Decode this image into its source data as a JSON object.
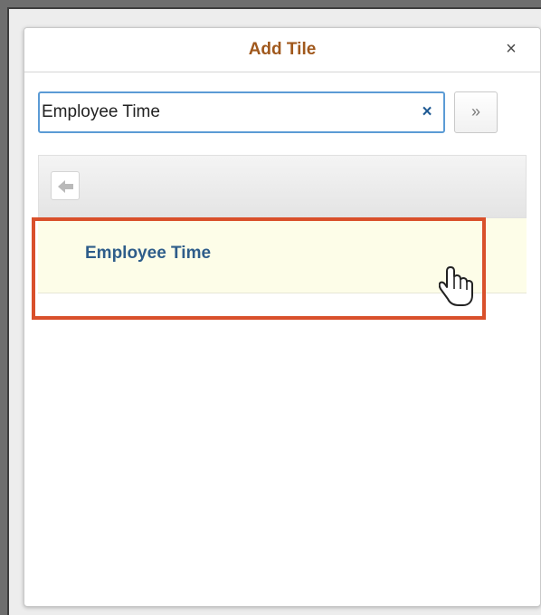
{
  "dialog": {
    "title": "Add Tile",
    "close_label": "×"
  },
  "search": {
    "value": "Employee Time",
    "clear_label": "×",
    "go_label": "»"
  },
  "results": {
    "back_icon": "back-arrow-icon",
    "items": [
      {
        "label": "Employee Time"
      }
    ]
  },
  "annotation": {
    "highlight_color": "#d9502b",
    "cursor_icon": "hand-pointer-icon"
  },
  "colors": {
    "title": "#a0581c",
    "result_text": "#2e5d8a",
    "result_background": "#fdfde8",
    "focus_border": "#5b9bd5"
  }
}
